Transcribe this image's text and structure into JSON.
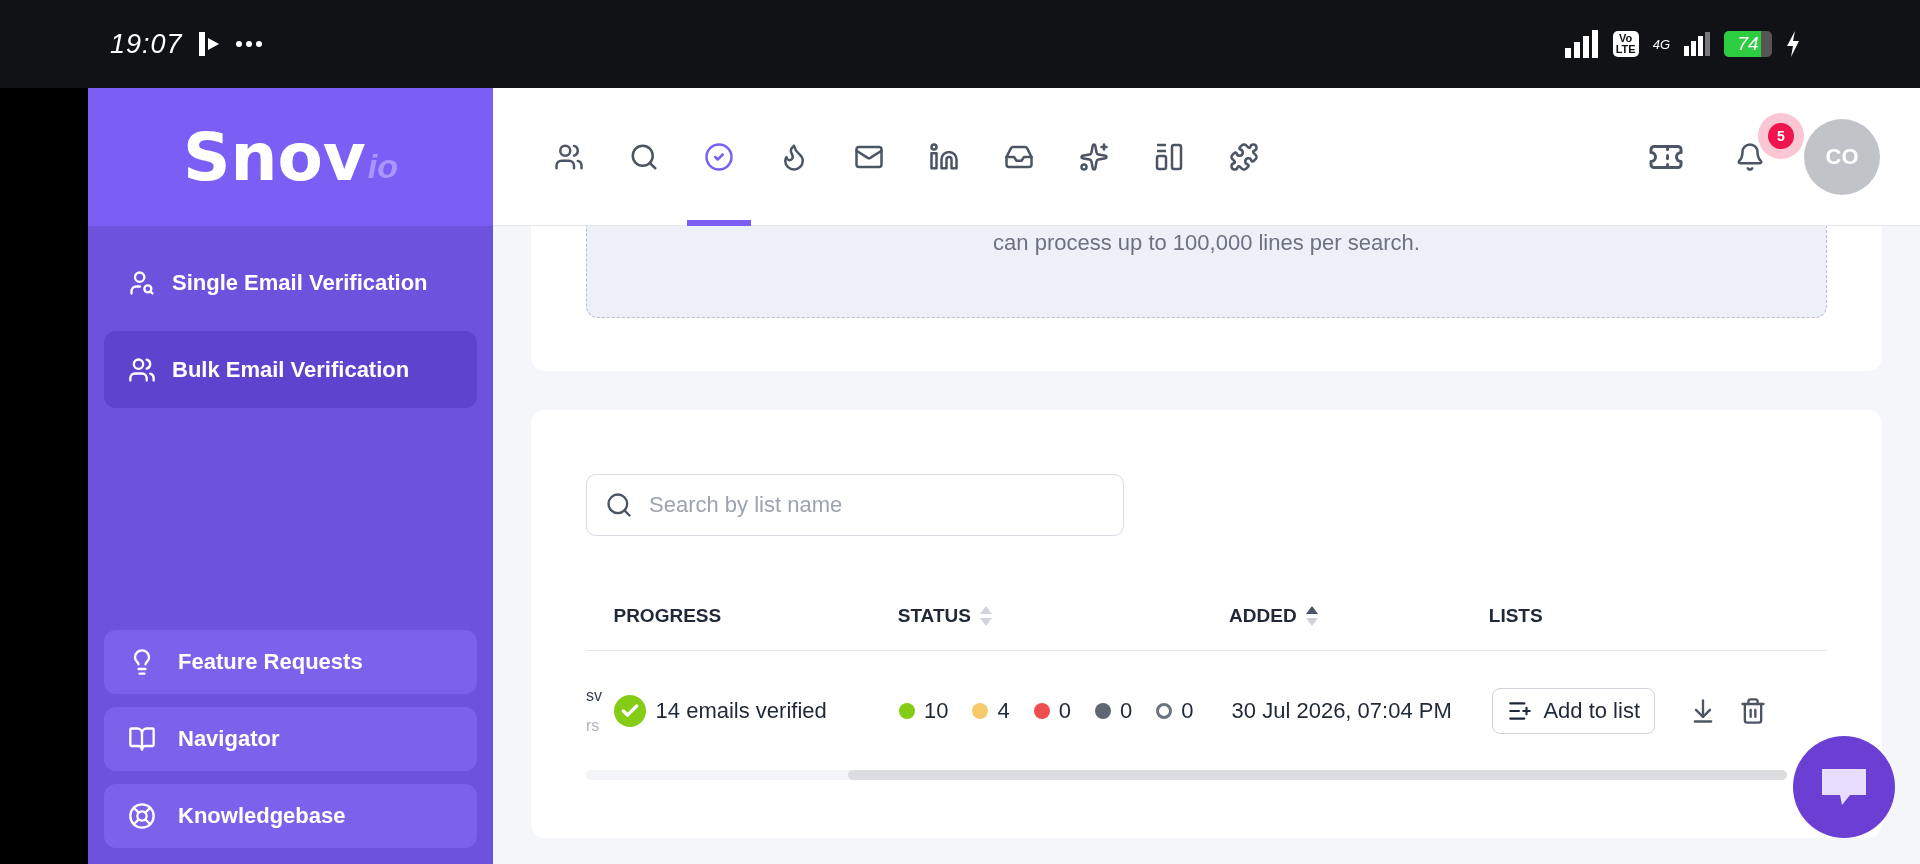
{
  "status_bar": {
    "time": "19:07",
    "volte_top": "Vo",
    "volte_bottom": "LTE",
    "network": "4G",
    "battery": "74"
  },
  "sidebar": {
    "logo": {
      "main": "Snov",
      "suffix": "io"
    },
    "items": [
      {
        "label": "Single Email Verification",
        "selected": false
      },
      {
        "label": "Bulk Email Verification",
        "selected": true
      }
    ],
    "bottom_links": [
      {
        "label": "Feature Requests"
      },
      {
        "label": "Navigator"
      },
      {
        "label": "Knowledgebase"
      }
    ]
  },
  "topbar": {
    "nav": [
      {
        "selected": false
      },
      {
        "selected": false
      },
      {
        "selected": true
      },
      {
        "selected": false
      },
      {
        "selected": false
      },
      {
        "selected": false
      },
      {
        "selected": false
      },
      {
        "selected": false
      },
      {
        "selected": false
      },
      {
        "selected": false
      }
    ],
    "notification_count": "5",
    "avatar": "CO"
  },
  "upload": {
    "hint": "can process up to 100,000 lines per search."
  },
  "lists": {
    "search": {
      "placeholder": "Search by list name"
    },
    "columns": [
      {
        "label": "PROGRESS",
        "sortable": false,
        "sorted": false
      },
      {
        "label": "STATUS",
        "sortable": true,
        "sorted": false
      },
      {
        "label": "ADDED",
        "sortable": true,
        "sorted": true
      },
      {
        "label": "LISTS",
        "sortable": false,
        "sorted": false
      }
    ],
    "rows": [
      {
        "column_1": [
          "sv",
          "rs"
        ],
        "progress": "14 emails verified",
        "done": true,
        "status": [
          {
            "kind": "dot",
            "color": "#84cc16",
            "count": "10"
          },
          {
            "kind": "dot",
            "color": "#f6c96b",
            "count": "4"
          },
          {
            "kind": "dot",
            "color": "#ef4e4e",
            "count": "0"
          },
          {
            "kind": "dot",
            "color": "#5f6773",
            "count": "0"
          },
          {
            "kind": "ring",
            "color": "#6b7280",
            "count": "0"
          }
        ],
        "added": "30 Jul 2026, 07:04 PM",
        "action": "Add to list"
      }
    ]
  }
}
